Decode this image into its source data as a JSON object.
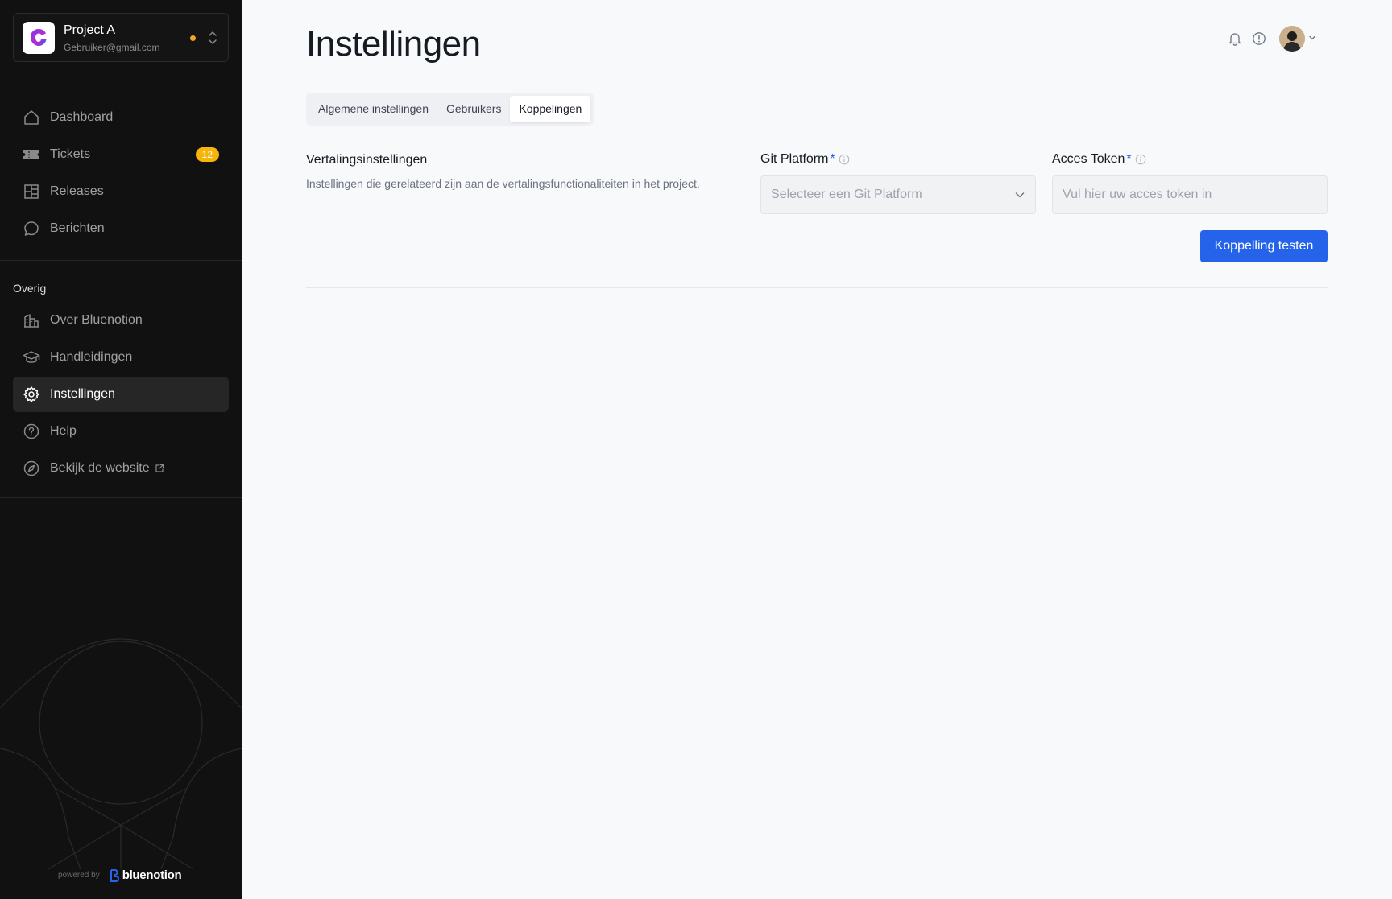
{
  "project": {
    "name": "Project A",
    "email": "Gebruiker@gmail.com",
    "status_color": "#f5a524"
  },
  "nav": {
    "main": [
      {
        "label": "Dashboard",
        "icon": "home-icon"
      },
      {
        "label": "Tickets",
        "icon": "ticket-icon",
        "badge": "12"
      },
      {
        "label": "Releases",
        "icon": "layout-icon"
      },
      {
        "label": "Berichten",
        "icon": "chat-bubble-icon"
      }
    ],
    "section_label": "Overig",
    "other": [
      {
        "label": "Over Bluenotion",
        "icon": "building-icon"
      },
      {
        "label": "Handleidingen",
        "icon": "graduation-cap-icon"
      },
      {
        "label": "Instellingen",
        "icon": "gear-icon",
        "active": true
      },
      {
        "label": "Help",
        "icon": "question-circle-icon"
      },
      {
        "label": "Bekijk de website",
        "icon": "compass-icon",
        "external": true
      }
    ]
  },
  "footer": {
    "powered_by": "powered by",
    "brand": "bluenotion"
  },
  "page": {
    "title": "Instellingen",
    "tabs": [
      {
        "label": "Algemene instellingen"
      },
      {
        "label": "Gebruikers"
      },
      {
        "label": "Koppelingen",
        "active": true
      }
    ]
  },
  "section": {
    "title": "Vertalingsinstellingen",
    "description": "Instellingen die gerelateerd zijn aan de vertalingsfunctionaliteiten in het project."
  },
  "form": {
    "git_platform": {
      "label": "Git Platform",
      "required_mark": "*",
      "placeholder": "Selecteer een Git Platform"
    },
    "access_token": {
      "label": "Acces Token",
      "required_mark": "*",
      "placeholder": "Vul hier uw acces token in",
      "value": ""
    },
    "test_button": "Koppelling testen"
  },
  "colors": {
    "accent": "#2563eb",
    "badge": "#f5b50b",
    "sidebar_bg": "#111111"
  }
}
